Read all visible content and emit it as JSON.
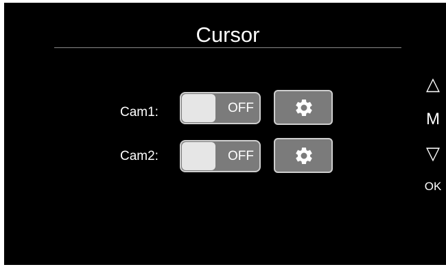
{
  "screen": {
    "title": "Cursor"
  },
  "cameras": [
    {
      "label": "Cam1:",
      "toggle_state": "OFF"
    },
    {
      "label": "Cam2:",
      "toggle_state": "OFF"
    }
  ],
  "side_buttons": {
    "up": "△",
    "menu": "M",
    "down": "▽",
    "ok": "OK"
  },
  "colors": {
    "background": "#000000",
    "toggle_track": "#7b7b7b",
    "toggle_knob": "#e6e6e6",
    "text": "#ffffff"
  },
  "icons": {
    "settings": "gear-icon"
  }
}
